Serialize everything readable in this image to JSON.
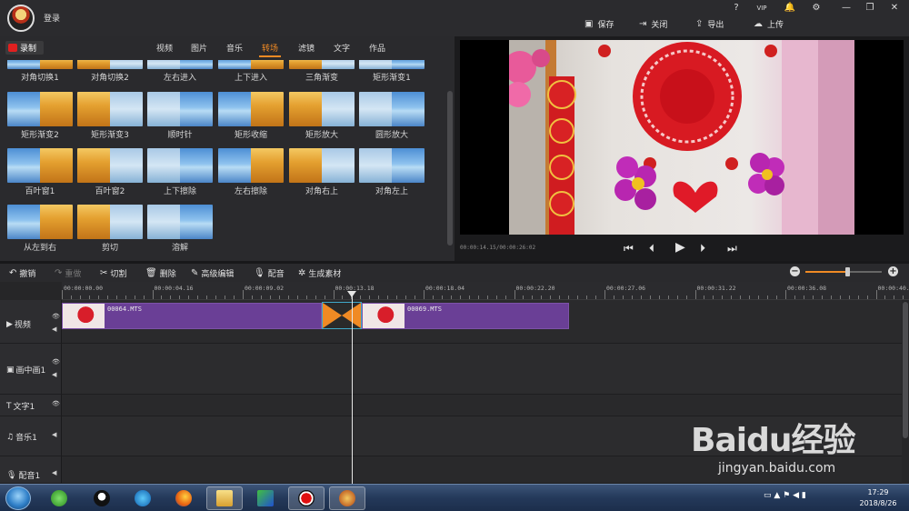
{
  "titlebar": {
    "login": "登录",
    "window_buttons": [
      "?",
      "VIP",
      "🔔",
      "⚙",
      "—",
      "❐",
      "✕"
    ],
    "actions": [
      {
        "label": "保存",
        "icon": "save-icon"
      },
      {
        "label": "关闭",
        "icon": "close-project-icon"
      },
      {
        "label": "导出",
        "icon": "export-icon"
      },
      {
        "label": "上传",
        "icon": "upload-icon"
      }
    ]
  },
  "left_panel": {
    "record_label": "录制",
    "tabs": [
      "视频",
      "图片",
      "音乐",
      "转场",
      "滤镜",
      "文字",
      "作品"
    ],
    "active_tab": "转场",
    "transitions": [
      "对角切换1",
      "对角切换2",
      "左右进入",
      "上下进入",
      "三角渐变",
      "矩形渐变1",
      "矩形渐变2",
      "矩形渐变3",
      "顺时针",
      "矩形收缩",
      "矩形放大",
      "圆形放大",
      "百叶窗1",
      "百叶窗2",
      "上下擦除",
      "左右擦除",
      "对角右上",
      "对角左上",
      "从左到右",
      "剪切",
      "溶解"
    ]
  },
  "preview": {
    "timecode": "00:00:14.15/00:00:26:02",
    "controls": [
      "⏮",
      "⏴",
      "▶",
      "⏵",
      "⏭"
    ]
  },
  "toolbar": {
    "undo": "撤销",
    "redo": "重做",
    "cut": "切割",
    "delete": "删除",
    "advanced_edit": "高级编辑",
    "dub": "配音",
    "generate": "生成素材",
    "zoom_level": 0.55
  },
  "timeline": {
    "ruler": [
      "00:00:00.00",
      "00:00:04.16",
      "00:00:09.02",
      "00:00:13.18",
      "00:00:18.04",
      "00:00:22.20",
      "00:00:27.06",
      "00:00:31.22",
      "00:00:36.08",
      "00:00:40."
    ],
    "tracks": [
      {
        "name": "视频",
        "icon": "play-icon"
      },
      {
        "name": "画中画1",
        "icon": "pip-icon"
      },
      {
        "name": "文字1",
        "icon": "text-icon"
      },
      {
        "name": "音乐1",
        "icon": "music-icon"
      },
      {
        "name": "配音1",
        "icon": "mic-icon"
      }
    ],
    "clips": [
      {
        "name": "00064.MTS"
      },
      {
        "name": "00069.MTS"
      }
    ]
  },
  "taskbar": {
    "time": "17:29",
    "date": "2018/8/26"
  },
  "watermark": {
    "brand": "Baidu经验",
    "url": "jingyan.baidu.com"
  }
}
